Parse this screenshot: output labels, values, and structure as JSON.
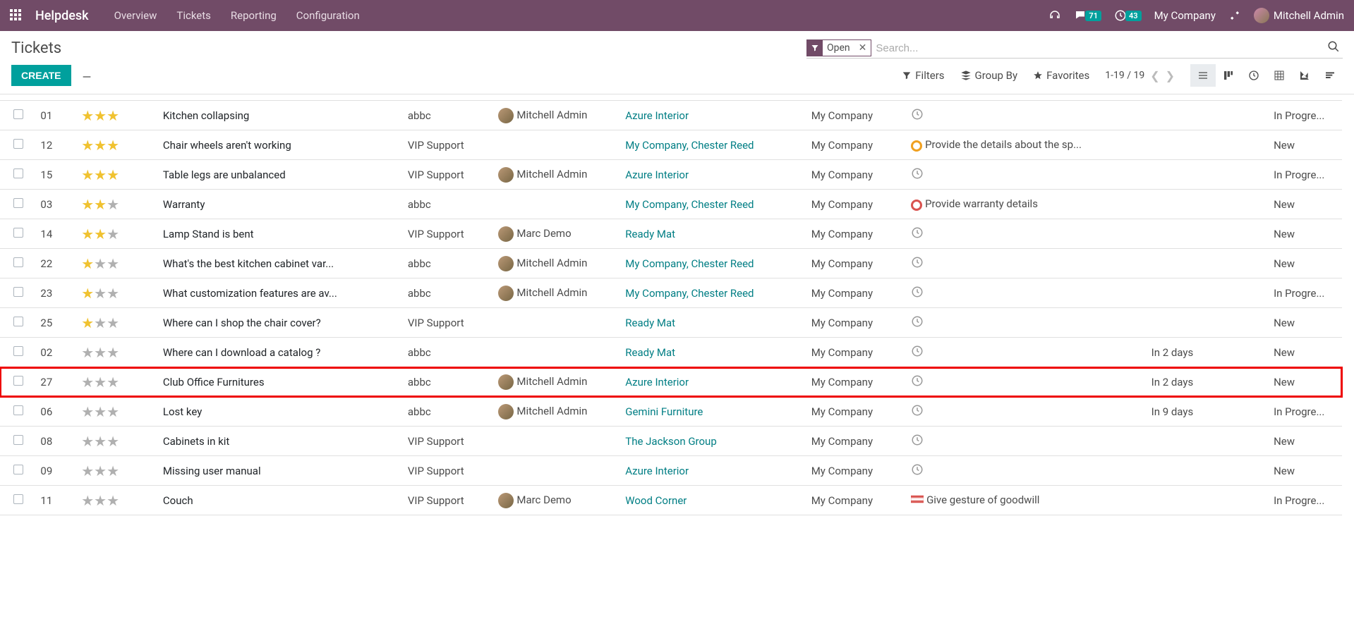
{
  "topbar": {
    "brand": "Helpdesk",
    "nav": [
      "Overview",
      "Tickets",
      "Reporting",
      "Configuration"
    ],
    "chat_badge": "71",
    "clock_badge": "43",
    "company": "My Company",
    "user": "Mitchell Admin"
  },
  "header": {
    "title": "Tickets",
    "facet_label": "Open",
    "search_placeholder": "Search..."
  },
  "controls": {
    "create": "CREATE",
    "filters": "Filters",
    "groupby": "Group By",
    "favorites": "Favorites",
    "pager": "1-19 / 19"
  },
  "rows": [
    {
      "id": "01",
      "stars": 3,
      "subject": "Kitchen collapsing",
      "team": "abbc",
      "assigned": "Mitchell Admin",
      "has_avatar": true,
      "customer": "Azure Interior",
      "customer_link": true,
      "company": "My Company",
      "activity_type": "clock",
      "activity_text": "",
      "due": "",
      "stage": "In Progre...",
      "highlighted": false
    },
    {
      "id": "12",
      "stars": 3,
      "subject": "Chair wheels aren't working",
      "team": "VIP Support",
      "assigned": "",
      "has_avatar": false,
      "customer": "My Company, Chester Reed",
      "customer_link": true,
      "company": "My Company",
      "activity_type": "ring-orange",
      "activity_text": "Provide the details about the sp...",
      "due": "",
      "stage": "New",
      "highlighted": false
    },
    {
      "id": "15",
      "stars": 3,
      "subject": "Table legs are unbalanced",
      "team": "VIP Support",
      "assigned": "Mitchell Admin",
      "has_avatar": true,
      "customer": "Azure Interior",
      "customer_link": true,
      "company": "My Company",
      "activity_type": "clock",
      "activity_text": "",
      "due": "",
      "stage": "In Progre...",
      "highlighted": false
    },
    {
      "id": "03",
      "stars": 2,
      "subject": "Warranty",
      "team": "abbc",
      "assigned": "",
      "has_avatar": false,
      "customer": "My Company, Chester Reed",
      "customer_link": true,
      "company": "My Company",
      "activity_type": "ring-red",
      "activity_text": "Provide warranty details",
      "due": "",
      "stage": "New",
      "highlighted": false
    },
    {
      "id": "14",
      "stars": 2,
      "subject": "Lamp Stand is bent",
      "team": "VIP Support",
      "assigned": "Marc Demo",
      "has_avatar": true,
      "customer": "Ready Mat",
      "customer_link": true,
      "company": "My Company",
      "activity_type": "clock",
      "activity_text": "",
      "due": "",
      "stage": "New",
      "highlighted": false
    },
    {
      "id": "22",
      "stars": 1,
      "subject": "What's the best kitchen cabinet var...",
      "team": "abbc",
      "assigned": "Mitchell Admin",
      "has_avatar": true,
      "customer": "My Company, Chester Reed",
      "customer_link": true,
      "company": "My Company",
      "activity_type": "clock",
      "activity_text": "",
      "due": "",
      "stage": "New",
      "highlighted": false
    },
    {
      "id": "23",
      "stars": 1,
      "subject": "What customization features are av...",
      "team": "abbc",
      "assigned": "Mitchell Admin",
      "has_avatar": true,
      "customer": "My Company, Chester Reed",
      "customer_link": true,
      "company": "My Company",
      "activity_type": "clock",
      "activity_text": "",
      "due": "",
      "stage": "In Progre...",
      "highlighted": false
    },
    {
      "id": "25",
      "stars": 1,
      "subject": "Where can I shop the chair cover?",
      "team": "VIP Support",
      "assigned": "",
      "has_avatar": false,
      "customer": "Ready Mat",
      "customer_link": true,
      "company": "My Company",
      "activity_type": "clock",
      "activity_text": "",
      "due": "",
      "stage": "New",
      "highlighted": false
    },
    {
      "id": "02",
      "stars": 0,
      "subject": "Where can I download a catalog ?",
      "team": "abbc",
      "assigned": "",
      "has_avatar": false,
      "customer": "Ready Mat",
      "customer_link": true,
      "company": "My Company",
      "activity_type": "clock",
      "activity_text": "",
      "due": "In 2 days",
      "stage": "New",
      "highlighted": false
    },
    {
      "id": "27",
      "stars": 0,
      "subject": "Club Office Furnitures",
      "team": "abbc",
      "assigned": "Mitchell Admin",
      "has_avatar": true,
      "customer": "Azure Interior",
      "customer_link": true,
      "company": "My Company",
      "activity_type": "clock",
      "activity_text": "",
      "due": "In 2 days",
      "stage": "New",
      "highlighted": true
    },
    {
      "id": "06",
      "stars": 0,
      "subject": "Lost key",
      "team": "abbc",
      "assigned": "Mitchell Admin",
      "has_avatar": true,
      "customer": "Gemini Furniture",
      "customer_link": true,
      "company": "My Company",
      "activity_type": "clock",
      "activity_text": "",
      "due": "In 9 days",
      "stage": "In Progre...",
      "highlighted": false
    },
    {
      "id": "08",
      "stars": 0,
      "subject": "Cabinets in kit",
      "team": "VIP Support",
      "assigned": "",
      "has_avatar": false,
      "customer": "The Jackson Group",
      "customer_link": true,
      "company": "My Company",
      "activity_type": "clock",
      "activity_text": "",
      "due": "",
      "stage": "New",
      "highlighted": false
    },
    {
      "id": "09",
      "stars": 0,
      "subject": "Missing user manual",
      "team": "VIP Support",
      "assigned": "",
      "has_avatar": false,
      "customer": "Azure Interior",
      "customer_link": true,
      "company": "My Company",
      "activity_type": "clock",
      "activity_text": "",
      "due": "",
      "stage": "New",
      "highlighted": false
    },
    {
      "id": "11",
      "stars": 0,
      "subject": "Couch",
      "team": "VIP Support",
      "assigned": "Marc Demo",
      "has_avatar": true,
      "customer": "Wood Corner",
      "customer_link": true,
      "company": "My Company",
      "activity_type": "flag",
      "activity_text": "Give gesture of goodwill",
      "due": "",
      "stage": "In Progre...",
      "highlighted": false
    }
  ]
}
